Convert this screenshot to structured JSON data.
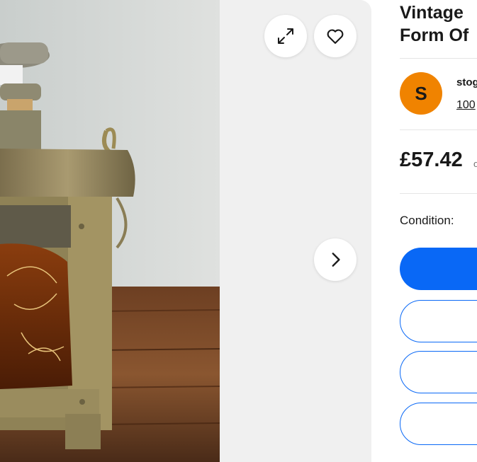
{
  "gallery": {
    "expand_icon": "expand-icon",
    "favorite_icon": "heart-icon",
    "next_icon": "chevron-right-icon"
  },
  "listing": {
    "title_line1": "Vintage",
    "title_line2": "Form Of"
  },
  "seller": {
    "avatar_initial": "S",
    "name": "stog",
    "feedback": "100"
  },
  "price": {
    "amount": "£57.42",
    "suffix": "o"
  },
  "condition": {
    "label": "Condition:"
  },
  "colors": {
    "primary": "#0968f6",
    "avatar": "#f08300",
    "gallery_bg": "#f0f0f0"
  }
}
